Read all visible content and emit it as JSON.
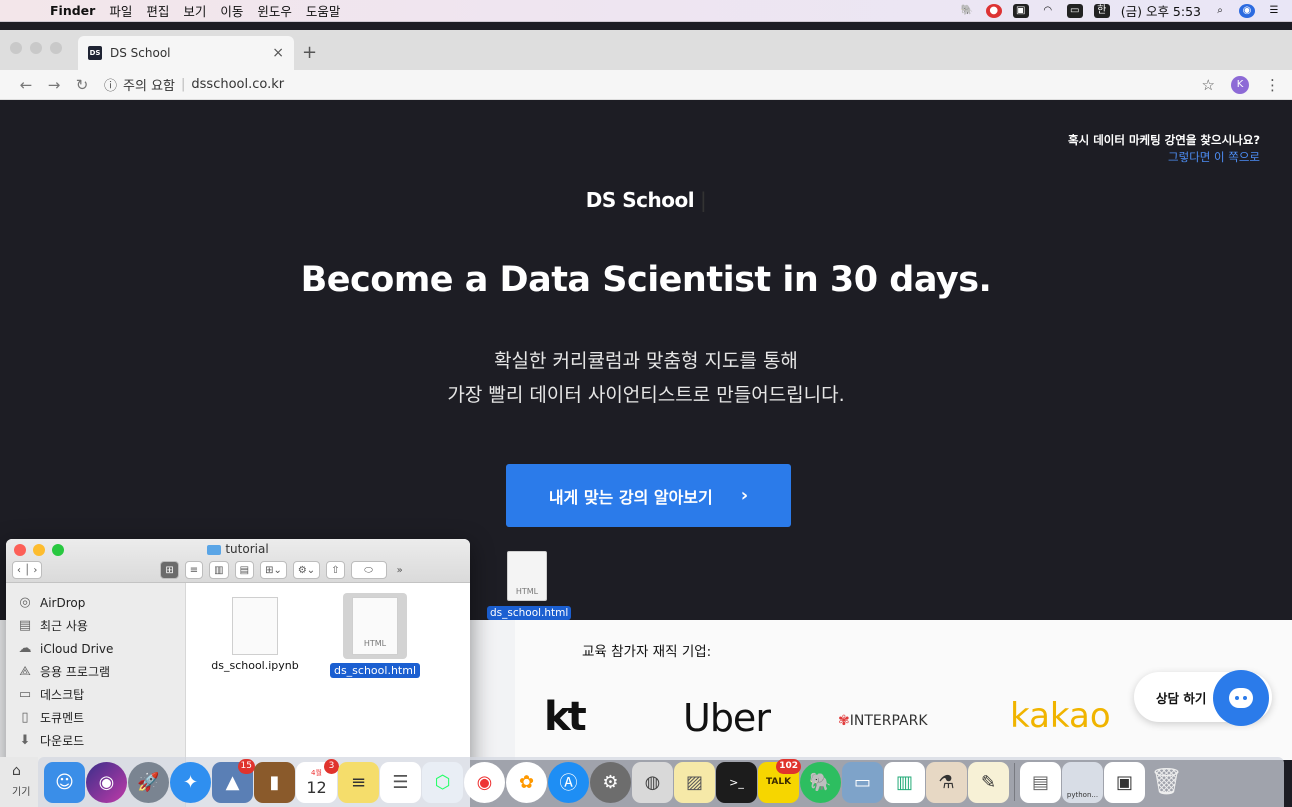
{
  "menubar": {
    "app_name": "Finder",
    "items": [
      "파일",
      "편집",
      "보기",
      "이동",
      "윈도우",
      "도움말"
    ],
    "clock": "(금) 오후 5:53",
    "ime": "한"
  },
  "browser": {
    "tab_title": "DS School",
    "favicon_text": "DS",
    "security_label": "주의 요함",
    "url": "dsschool.co.kr",
    "profile_initial": "K"
  },
  "site": {
    "promo_question": "혹시 데이터 마케팅 강연을 찾으시나요?",
    "promo_link": "그렇다면 이 쪽으로",
    "brand": "DS School",
    "hero": "Become a Data Scientist in 30 days.",
    "sub_line1": "확실한 커리큘럼과 맞춤형 지도를 통해",
    "sub_line2": "가장 빨리 데이터 사이언티스트로 만들어드립니다.",
    "cta": "내게 맞는 강의 알아보기",
    "partners_title": "교육 참가자 재직 기업:",
    "partners": [
      "kt",
      "Uber",
      "INTERPARK",
      "kakao"
    ],
    "chat_label": "상담 하기"
  },
  "desktop": {
    "file_name": "ds_school.html",
    "file_type": "HTML"
  },
  "finder": {
    "folder": "tutorial",
    "sidebar": [
      "AirDrop",
      "최근 사용",
      "iCloud Drive",
      "응용 프로그램",
      "데스크탑",
      "도큐멘트",
      "다운로드"
    ],
    "files": [
      {
        "name": "ds_school.ipynb",
        "type": ""
      },
      {
        "name": "ds_school.html",
        "type": "HTML"
      }
    ]
  },
  "dock": {
    "left_label": "기기",
    "badges": {
      "photos": "15",
      "calendar": "3",
      "kakaotalk": "102"
    },
    "calendar_day": "12",
    "calendar_month": "4월",
    "preview_label": "python..."
  },
  "colors": {
    "site_bg": "#1d1d24",
    "accent": "#2b7bea",
    "link": "#4d8ef5",
    "kakao": "#f0b400",
    "selection": "#1b5fd1"
  }
}
